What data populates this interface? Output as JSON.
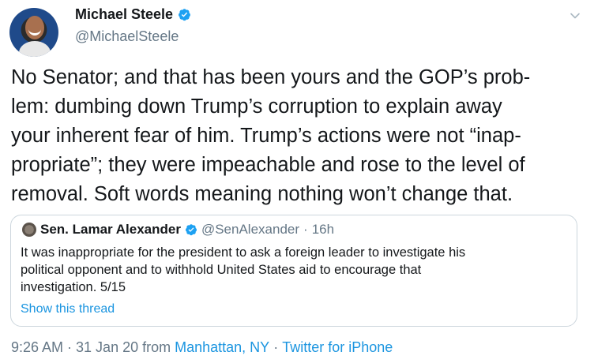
{
  "author": {
    "display_name": "Michael Steele",
    "handle": "@MichaelSteele"
  },
  "tweet": {
    "lines": [
      "No Senator; and that has been yours and the GOP’s prob-",
      "lem: dumbing down Trump’s corruption to explain away",
      "your inherent fear of him. Trump’s actions were not “inap-",
      "propriate”; they were impeachable and rose to the level of",
      "removal. Soft words meaning nothing won’t change that."
    ]
  },
  "quoted": {
    "display_name": "Sen. Lamar Alexander",
    "handle": "@SenAlexander",
    "separator": "·",
    "time": "16h",
    "lines": [
      "It was inappropriate for the president to ask a foreign leader to investigate his",
      "political opponent and to withhold United States aid to encourage that",
      "investigation. 5/15"
    ],
    "show_thread": "Show this thread"
  },
  "meta": {
    "timestamp": "9:26 AM · 31 Jan 20 from",
    "location": "Manhattan, NY",
    "separator": "·",
    "client": "Twitter for iPhone"
  },
  "colors": {
    "link": "#1b95e0",
    "secondary_text": "#657786",
    "verified": "#1da1f2",
    "border": "#ccd6dd"
  },
  "icons": [
    "verified-badge-icon",
    "chevron-down-icon"
  ]
}
